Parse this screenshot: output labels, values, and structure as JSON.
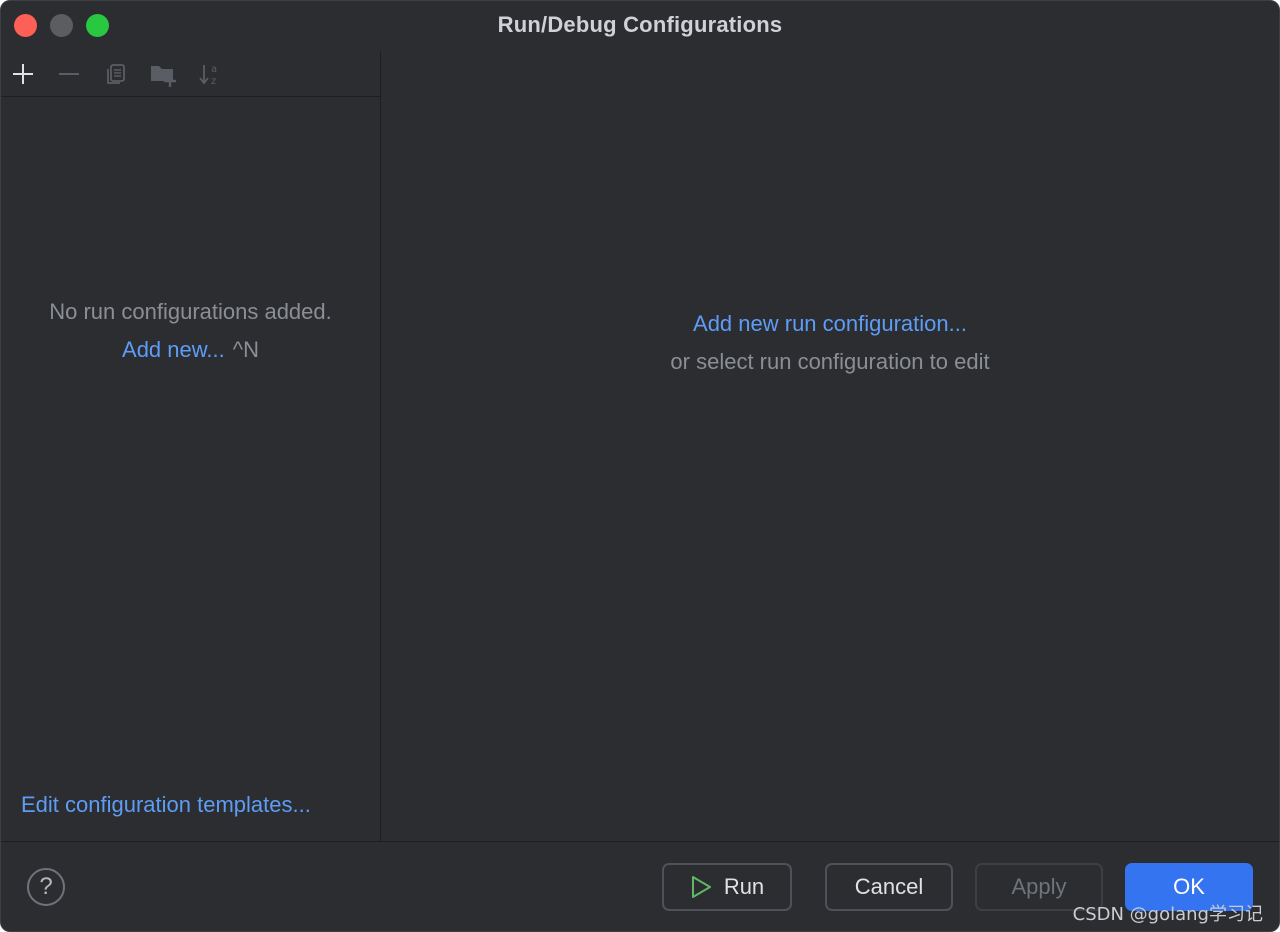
{
  "window": {
    "title": "Run/Debug Configurations"
  },
  "colors": {
    "close": "#fe5f57",
    "minimize": "#5b5d61",
    "maximize": "#28c840",
    "link": "#5e9cf6",
    "primary_button": "#3574f0",
    "run_icon": "#5fb865"
  },
  "toolbar": {
    "icons": [
      "add-icon",
      "remove-icon",
      "copy-icon",
      "new-folder-icon",
      "sort-alphabetically-icon"
    ]
  },
  "left_pane": {
    "empty_message": "No run configurations added.",
    "add_new_link": "Add new...",
    "add_new_shortcut": "^N",
    "edit_templates_link": "Edit configuration templates..."
  },
  "right_pane": {
    "add_link": "Add new run configuration...",
    "hint": "or select run configuration to edit"
  },
  "footer": {
    "help_label": "?",
    "run_label": "Run",
    "cancel_label": "Cancel",
    "apply_label": "Apply",
    "ok_label": "OK",
    "watermark": "CSDN @golang学习记"
  }
}
